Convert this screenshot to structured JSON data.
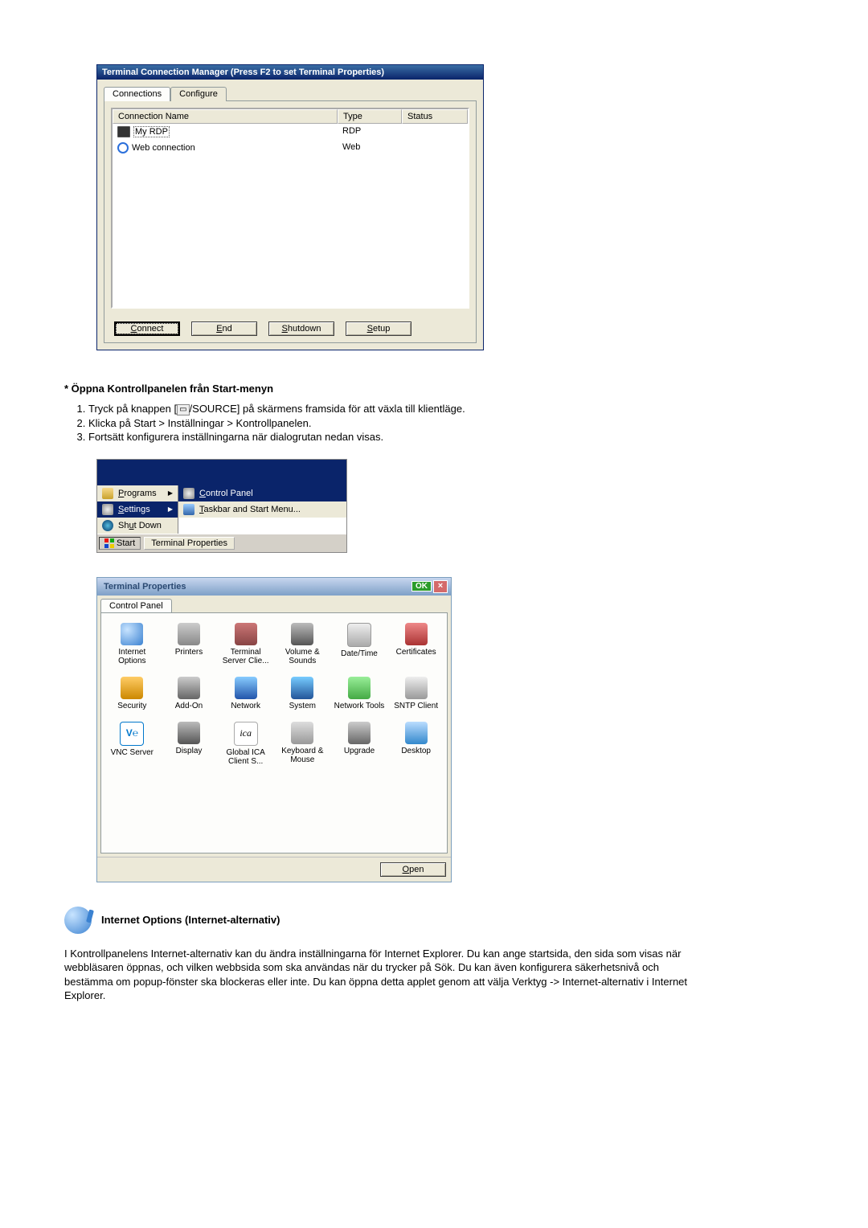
{
  "win1": {
    "title": "Terminal Connection Manager (Press F2 to set Terminal Properties)",
    "tabs": {
      "connections": "Connections",
      "configure": "Configure"
    },
    "columns": {
      "name": "Connection Name",
      "type": "Type",
      "status": "Status"
    },
    "rows": [
      {
        "name": "My RDP",
        "type": "RDP",
        "status": "",
        "icon": "monitor",
        "selected": true
      },
      {
        "name": "Web connection",
        "type": "Web",
        "status": "",
        "icon": "ie",
        "selected": false
      }
    ],
    "buttons": {
      "connect": "Connect",
      "end": "End",
      "shutdown": "Shutdown",
      "setup": "Setup"
    }
  },
  "text": {
    "heading1": "* Öppna Kontrollpanelen från Start-menyn",
    "step1a": "Tryck på knappen [",
    "step1b": "/SOURCE] på skärmens framsida för att växla till klientläge.",
    "source_chip": "▭",
    "step2": "Klicka på Start > Inställningar > Kontrollpanelen.",
    "step3": "Fortsätt konfigurera inställningarna när dialogrutan nedan visas."
  },
  "startmenu": {
    "programs": "Programs",
    "settings": "Settings",
    "shutdown": "Shut Down",
    "control_panel": "Control Panel",
    "taskbar_menu": "Taskbar and Start Menu...",
    "start": "Start",
    "task": "Terminal Properties"
  },
  "win2": {
    "title": "Terminal Properties",
    "ok": "OK",
    "tab": "Control Panel",
    "items": [
      {
        "label": "Internet Options",
        "icon": "ci-globe"
      },
      {
        "label": "Printers",
        "icon": "ci-printer"
      },
      {
        "label": "Terminal Server Clie...",
        "icon": "ci-terminal"
      },
      {
        "label": "Volume & Sounds",
        "icon": "ci-vol"
      },
      {
        "label": "Date/Time",
        "icon": "ci-date"
      },
      {
        "label": "Certificates",
        "icon": "ci-cert"
      },
      {
        "label": "Security",
        "icon": "ci-sec"
      },
      {
        "label": "Add-On",
        "icon": "ci-addon"
      },
      {
        "label": "Network",
        "icon": "ci-net"
      },
      {
        "label": "System",
        "icon": "ci-sys"
      },
      {
        "label": "Network Tools",
        "icon": "ci-nettools"
      },
      {
        "label": "SNTP Client",
        "icon": "ci-sntp"
      },
      {
        "label": "VNC Server",
        "icon": "ci-vnc",
        "glyph": "V℮"
      },
      {
        "label": "Display",
        "icon": "ci-disp"
      },
      {
        "label": "Global ICA Client S...",
        "icon": "ci-ica",
        "glyph": "ica"
      },
      {
        "label": "Keyboard & Mouse",
        "icon": "ci-kb"
      },
      {
        "label": "Upgrade",
        "icon": "ci-upg"
      },
      {
        "label": "Desktop",
        "icon": "ci-desk"
      }
    ],
    "open": "Open"
  },
  "section": {
    "title": "Internet Options (Internet-alternativ)",
    "para": "I Kontrollpanelens Internet-alternativ kan du ändra inställningarna för Internet Explorer. Du kan ange startsida, den sida som visas när webbläsaren öppnas, och vilken webbsida som ska användas när du trycker på Sök. Du kan även konfigurera säkerhetsnivå och bestämma om popup-fönster ska blockeras eller inte. Du kan öppna detta applet genom att välja Verktyg -> Internet-alternativ i Internet Explorer."
  }
}
